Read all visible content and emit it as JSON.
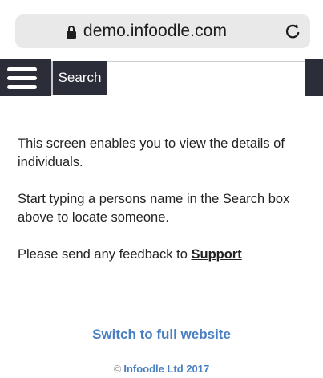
{
  "browser": {
    "url": "demo.infoodle.com",
    "lock_icon": "lock-icon",
    "reload_icon": "reload-icon"
  },
  "nav": {
    "menu_icon": "hamburger-icon",
    "search_label": "Search",
    "search_value": ""
  },
  "content": {
    "intro": "This screen enables you to view the details of individuals.",
    "instructions": "Start typing a persons name in the Search box above to locate someone.",
    "feedback_prefix": "Please send any feedback to ",
    "support_link": "Support"
  },
  "links": {
    "full_website": "Switch to full website"
  },
  "footer": {
    "copyright_symbol": "©",
    "copyright_text": "Infoodle Ltd 2017"
  },
  "colors": {
    "nav_dark": "#2b2d38",
    "link_blue": "#4a7fc1",
    "url_bar_bg": "#e9e9ea"
  }
}
